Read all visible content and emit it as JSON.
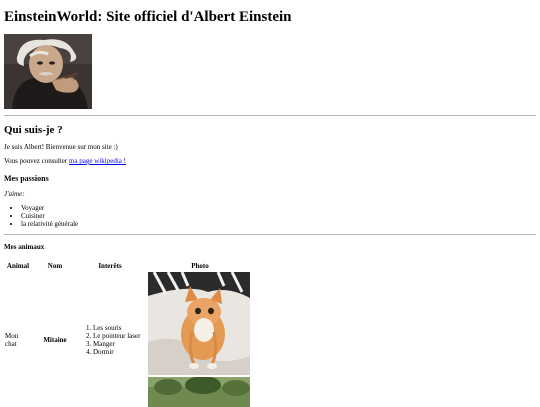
{
  "page": {
    "title": "EinsteinWorld: Site officiel d'Albert Einstein"
  },
  "about": {
    "heading": "Qui suis-je ?",
    "intro": "Je suis Albert! Bienvenue sur mon site :)",
    "wiki_prefix": "Vous pouvez consulter ",
    "wiki_link": "ma page wikipedia !"
  },
  "passions": {
    "heading": "Mes passions",
    "lead": "J'aime:",
    "items": [
      "Voyager",
      "Cuisiner",
      "la relativité générale"
    ]
  },
  "animals": {
    "heading": "Mes animaux",
    "columns": [
      "Animal",
      "Nom",
      "Interêts",
      "Photo"
    ],
    "rows": [
      {
        "animal": "Mon chat",
        "name": "Mitaine",
        "interests": [
          "Les souris",
          "Le pointeur laser",
          "Manger",
          "Dormir"
        ]
      }
    ]
  }
}
